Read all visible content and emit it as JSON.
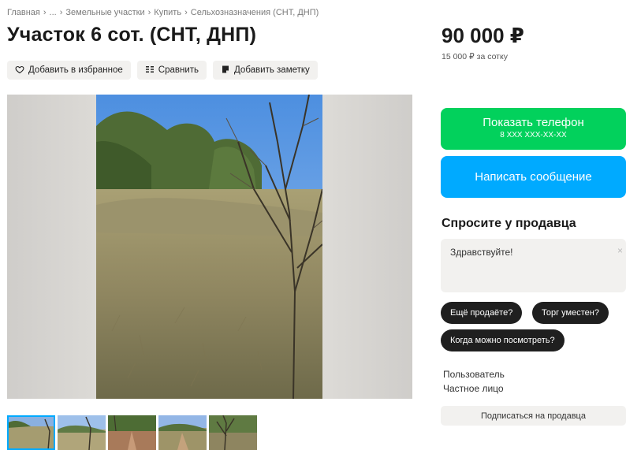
{
  "breadcrumb": {
    "items": [
      "Главная",
      "...",
      "Земельные участки",
      "Купить",
      "Сельхозназначения (СНТ, ДНП)"
    ],
    "separator": "›"
  },
  "listing": {
    "title": "Участок 6 сот. (СНТ, ДНП)",
    "price": "90 000 ₽",
    "price_per_unit": "15 000 ₽ за сотку"
  },
  "actions": {
    "favorite_label": "Добавить в избранное",
    "compare_label": "Сравнить",
    "note_label": "Добавить заметку"
  },
  "gallery": {
    "thumbnail_count": 5,
    "active_index": 0
  },
  "contact": {
    "show_phone_label": "Показать телефон",
    "phone_masked": "8 XXX XXX-XX-XX",
    "message_label": "Написать сообщение"
  },
  "ask": {
    "title": "Спросите у продавца",
    "message_value": "Здравствуйте!",
    "close_glyph": "×",
    "chips": [
      "Ещё продаёте?",
      "Торг уместен?",
      "Когда можно посмотреть?"
    ]
  },
  "seller": {
    "type": "Пользователь",
    "kind": "Частное лицо",
    "subscribe_label": "Подписаться на продавца"
  },
  "colors": {
    "phone_button": "#02d15c",
    "message_button": "#00aaff",
    "chip_background": "#1f1f1f",
    "secondary_background": "#f2f1ef",
    "active_thumbnail_outline": "#00aaff"
  },
  "icons": {
    "favorite": "heart-icon",
    "compare": "compare-icon",
    "note": "note-icon"
  }
}
